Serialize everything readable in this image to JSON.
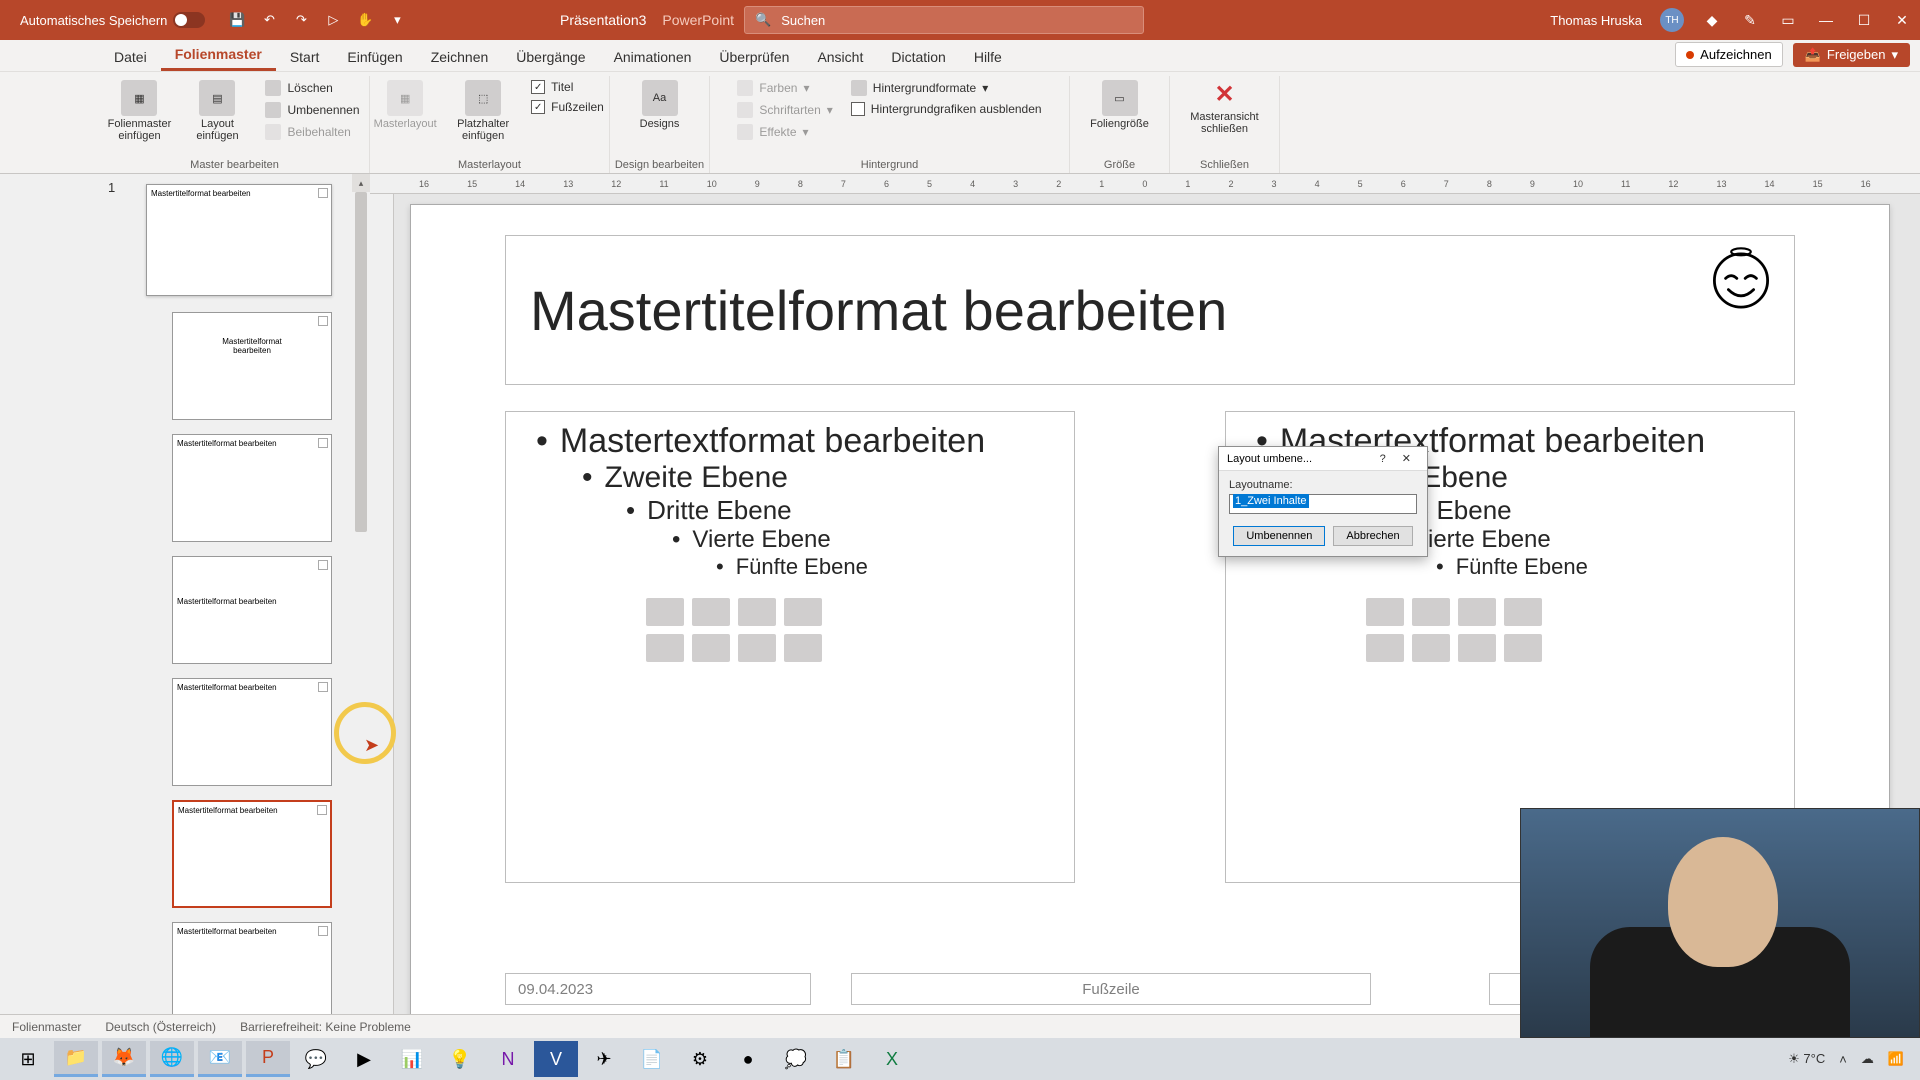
{
  "titlebar": {
    "autosave_label": "Automatisches Speichern",
    "filename": "Präsentation3",
    "app": "PowerPoint",
    "search_placeholder": "Suchen",
    "user": "Thomas Hruska",
    "user_initials": "TH"
  },
  "tabs": {
    "datei": "Datei",
    "folienmaster": "Folienmaster",
    "start": "Start",
    "einfuegen": "Einfügen",
    "zeichnen": "Zeichnen",
    "uebergaenge": "Übergänge",
    "animationen": "Animationen",
    "ueberpruefen": "Überprüfen",
    "ansicht": "Ansicht",
    "dictation": "Dictation",
    "hilfe": "Hilfe",
    "aufzeichnen": "Aufzeichnen",
    "freigeben": "Freigeben"
  },
  "ribbon": {
    "master_bearbeiten": "Master bearbeiten",
    "folienmaster_einfuegen": "Folienmaster einfügen",
    "layout_einfuegen": "Layout einfügen",
    "loeschen": "Löschen",
    "umbenennen": "Umbenennen",
    "beibehalten": "Beibehalten",
    "masterlayout_group": "Masterlayout",
    "masterlayout_btn": "Masterlayout",
    "platzhalter": "Platzhalter einfügen",
    "titel": "Titel",
    "fusszeilen": "Fußzeilen",
    "design_bearbeiten": "Design bearbeiten",
    "designs": "Designs",
    "hintergrund_group": "Hintergrund",
    "farben": "Farben",
    "schriftarten": "Schriftarten",
    "effekte": "Effekte",
    "hintergrundformate": "Hintergrundformate",
    "hg_ausblenden": "Hintergrundgrafiken ausblenden",
    "groesse_group": "Größe",
    "foliengroesse": "Foliengröße",
    "schliessen_group": "Schließen",
    "masteransicht_schliessen": "Masteransicht schließen"
  },
  "thumbs": {
    "number_1": "1"
  },
  "slide": {
    "title": "Mastertitelformat bearbeiten",
    "lvl1": "Mastertextformat bearbeiten",
    "lvl2": "Zweite Ebene",
    "lvl3": "Dritte Ebene",
    "lvl4": "Vierte Ebene",
    "lvl5": "Fünfte Ebene",
    "footer_date": "09.04.2023",
    "footer_mid": "Fußzeile"
  },
  "dialog": {
    "title": "Layout umbene...",
    "label": "Layoutname:",
    "value": "1_Zwei Inhalte",
    "ok": "Umbenennen",
    "cancel": "Abbrechen"
  },
  "status": {
    "mode": "Folienmaster",
    "lang": "Deutsch (Österreich)",
    "access": "Barrierefreiheit: Keine Probleme"
  },
  "ruler": [
    "16",
    "15",
    "14",
    "13",
    "12",
    "11",
    "10",
    "9",
    "8",
    "7",
    "6",
    "5",
    "4",
    "3",
    "2",
    "1",
    "0",
    "1",
    "2",
    "3",
    "4",
    "5",
    "6",
    "7",
    "8",
    "9",
    "10",
    "11",
    "12",
    "13",
    "14",
    "15",
    "16"
  ],
  "tray": {
    "temp": "7°C"
  }
}
